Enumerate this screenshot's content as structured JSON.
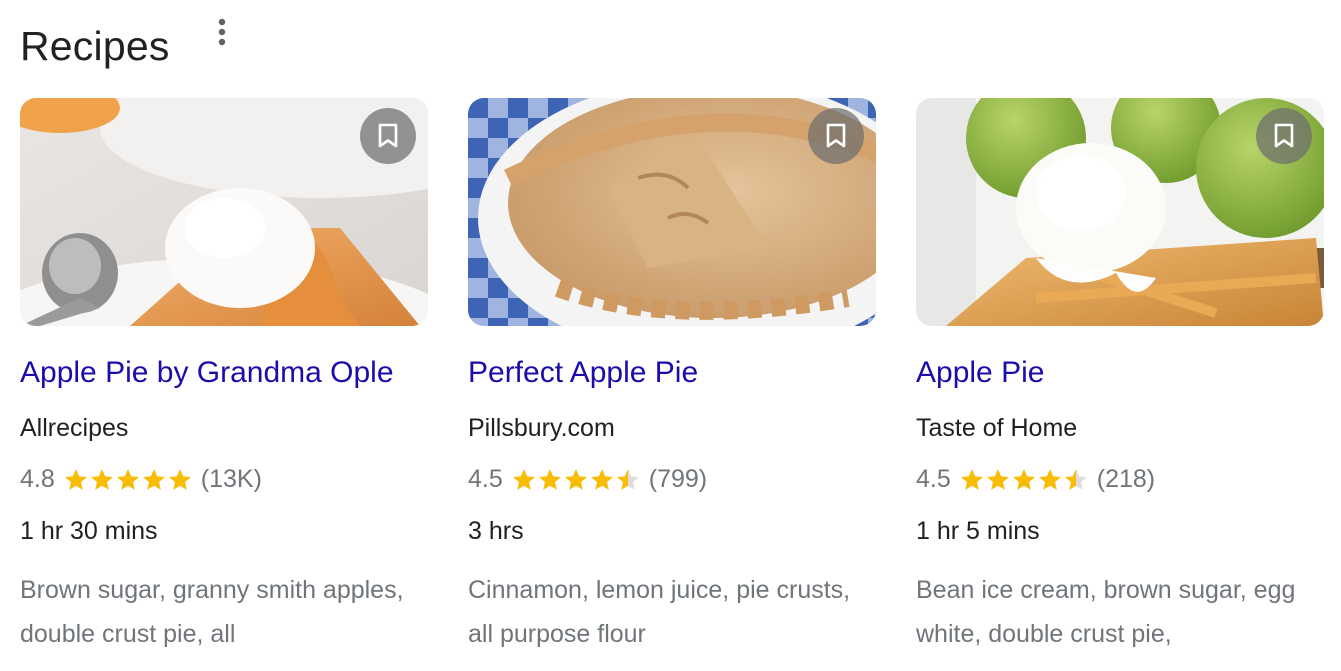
{
  "section": {
    "title": "Recipes",
    "more_icon": "more-vert-icon"
  },
  "colors": {
    "title_link": "#1a0dab",
    "star": "#fbbc04",
    "star_empty": "#dadce0",
    "muted": "#70757a",
    "text": "#202124"
  },
  "recipes": [
    {
      "title": "Apple Pie by Grandma Ople",
      "source": "Allrecipes",
      "rating": "4.8",
      "rating_value": 4.8,
      "reviews": "(13K)",
      "time": "1 hr 30 mins",
      "ingredients": "Brown sugar, granny smith apples, double crust pie, all",
      "save_icon": "bookmark-icon"
    },
    {
      "title": "Perfect Apple Pie",
      "source": "Pillsbury.com",
      "rating": "4.5",
      "rating_value": 4.5,
      "reviews": "(799)",
      "time": "3 hrs",
      "ingredients": "Cinnamon, lemon juice, pie crusts, all purpose flour",
      "save_icon": "bookmark-icon"
    },
    {
      "title": "Apple Pie",
      "source": "Taste of Home",
      "rating": "4.5",
      "rating_value": 4.5,
      "reviews": "(218)",
      "time": "1 hr 5 mins",
      "ingredients": "Bean ice cream, brown sugar, egg white, double crust pie,",
      "save_icon": "bookmark-icon"
    }
  ]
}
